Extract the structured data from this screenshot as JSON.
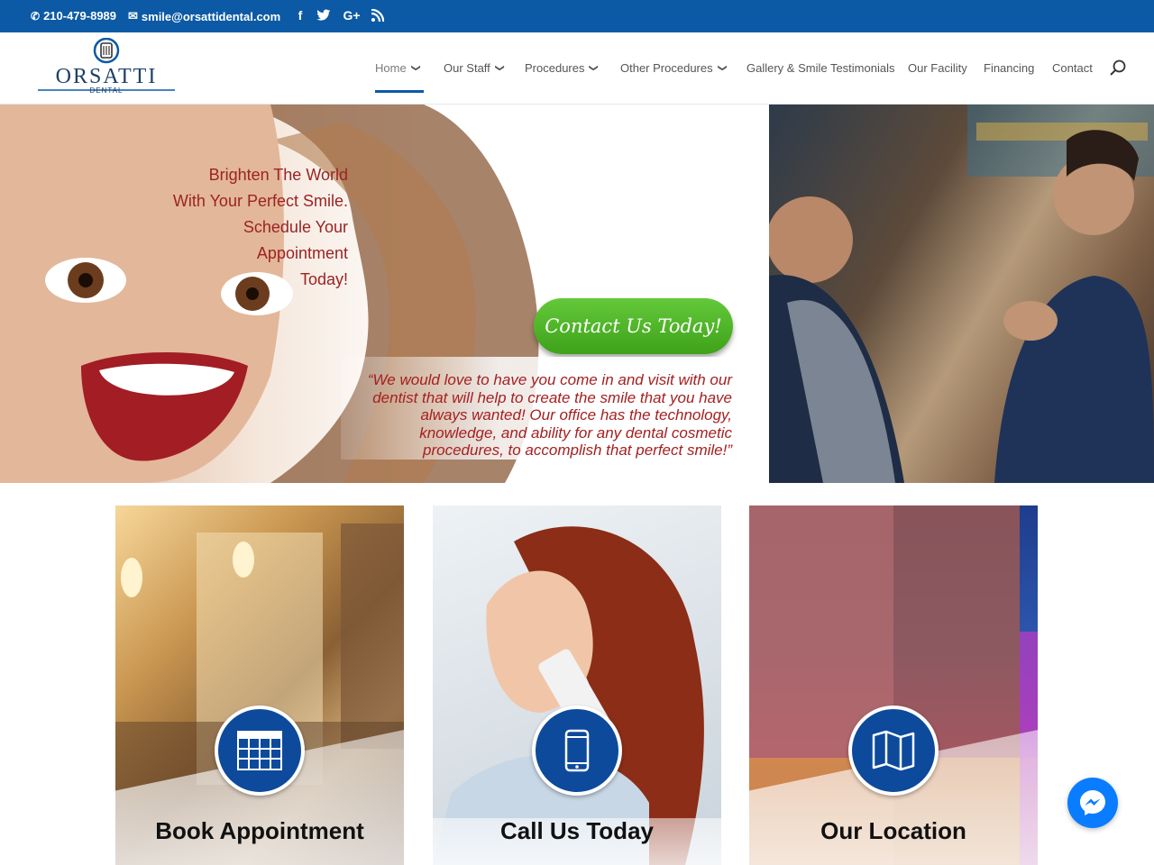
{
  "topbar": {
    "phone": "210-479-8989",
    "email": "smile@orsattidental.com",
    "social": [
      {
        "icon": "facebook-icon",
        "glyph": "f"
      },
      {
        "icon": "twitter-icon",
        "glyph": "🐦"
      },
      {
        "icon": "google-plus-icon",
        "glyph": "G+"
      },
      {
        "icon": "rss-icon",
        "glyph": "⌁"
      }
    ]
  },
  "logo": {
    "name": "ORSATTI",
    "sub": "DENTAL"
  },
  "nav": {
    "items": [
      {
        "label": "Home",
        "has_dropdown": true,
        "active": true
      },
      {
        "label": "Our Staff",
        "has_dropdown": true
      },
      {
        "label": "Procedures",
        "has_dropdown": true
      },
      {
        "label": "Other Procedures",
        "has_dropdown": true
      },
      {
        "label": "Gallery & Smile Testimonials",
        "has_dropdown": false
      },
      {
        "label": "Our Facility",
        "has_dropdown": false
      },
      {
        "label": "Financing",
        "has_dropdown": false
      },
      {
        "label": "Contact",
        "has_dropdown": false
      }
    ]
  },
  "hero": {
    "tagline_lines": [
      "Brighten The World",
      "With Your Perfect Smile.",
      "Schedule Your",
      "Appointment",
      "Today!"
    ],
    "cta_label": "Contact Us Today!",
    "quote": "“We would love to have you come in and visit with our dentist that will help to create the smile that you have always wanted! Our office has the technology, knowledge, and ability for any dental cosmetic procedures, to accomplish that perfect smile!”"
  },
  "cards": [
    {
      "label": "Book Appointment",
      "icon": "calendar-icon"
    },
    {
      "label": "Call Us Today",
      "icon": "smartphone-icon"
    },
    {
      "label": "Our Location",
      "icon": "map-icon"
    }
  ],
  "colors": {
    "brand_blue": "#0c5aa6",
    "circle_blue": "#0d4a9c",
    "tagline_red": "#9b2323",
    "cta_green": "#4cb229",
    "messenger_blue": "#0a7cff"
  }
}
